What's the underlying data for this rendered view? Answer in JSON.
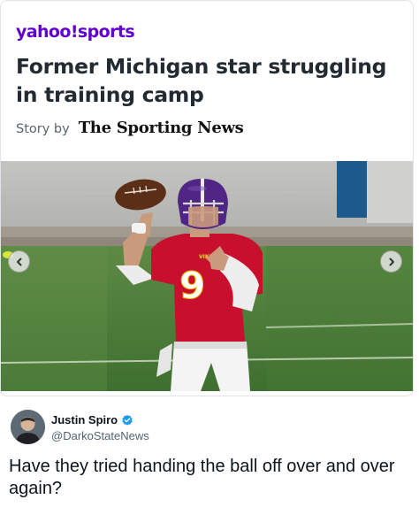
{
  "article": {
    "source_logo": "yahoo!sports",
    "headline": "Former Michigan star struggling in training camp",
    "byline_prefix": "Story by",
    "publisher": "The Sporting News",
    "jersey_number": "9"
  },
  "carousel": {
    "prev_icon": "chevron-left-icon",
    "next_icon": "chevron-right-icon"
  },
  "tweet": {
    "author_name": "Justin Spiro",
    "handle": "@DarkoStateNews",
    "text": "Have they tried handing the ball off over and over again?",
    "verified_color": "#1d9bf0"
  },
  "colors": {
    "brand": "#6001d2",
    "jersey": "#c8102e",
    "helmet": "#4f2683"
  }
}
